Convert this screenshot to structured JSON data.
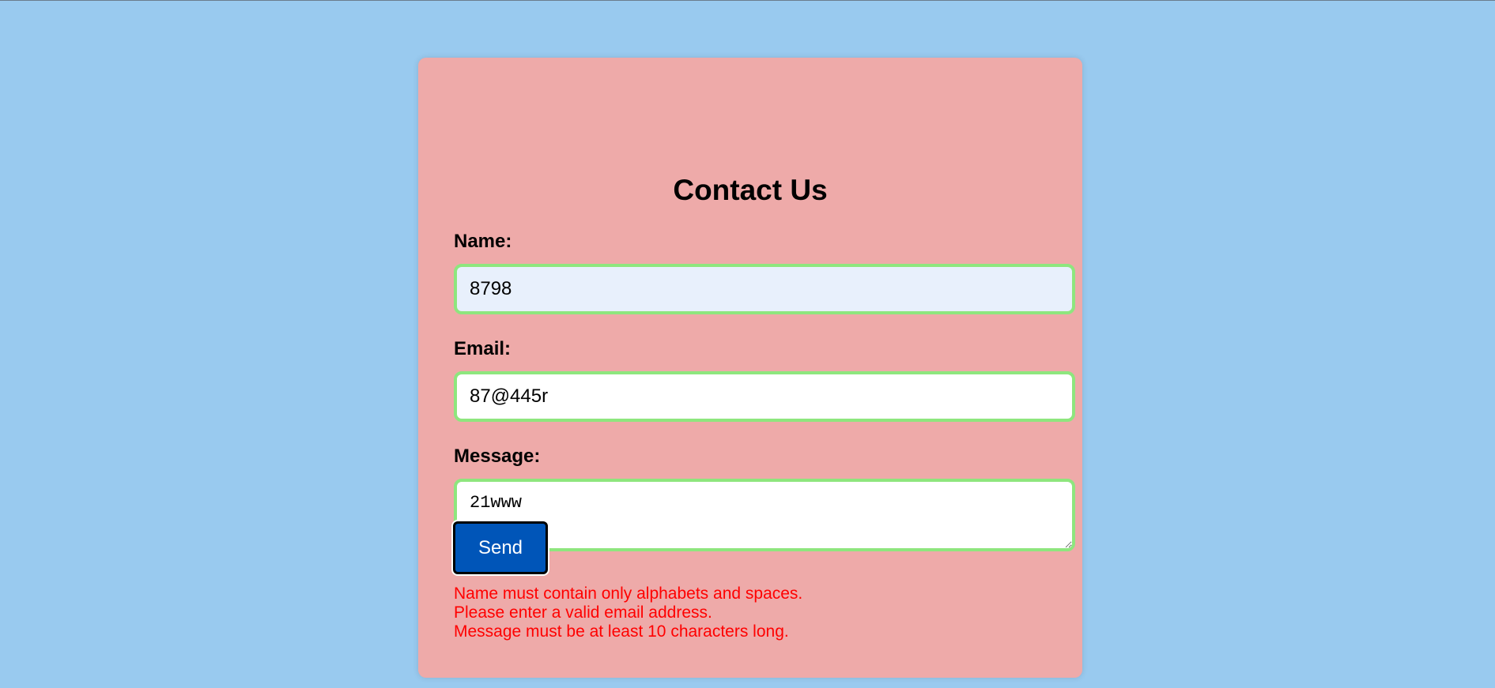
{
  "form": {
    "title": "Contact Us",
    "name_label": "Name:",
    "name_value": "8798",
    "email_label": "Email:",
    "email_value": "87@445r",
    "message_label": "Message:",
    "message_value": "21www",
    "send_label": "Send"
  },
  "errors": [
    "Name must contain only alphabets and spaces.",
    "Please enter a valid email address.",
    "Message must be at least 10 characters long."
  ],
  "colors": {
    "page_background": "#99caef",
    "card_background": "#eeaaa9",
    "field_border": "#8ee67e",
    "button_background": "#0055b8",
    "error_text": "#ff0000"
  }
}
